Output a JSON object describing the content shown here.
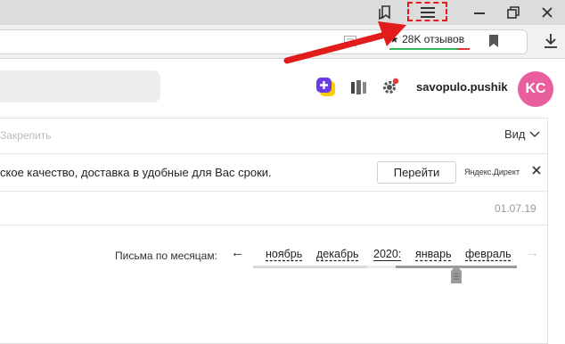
{
  "browser": {
    "reviews_text": "★ 28K отзывов"
  },
  "mail": {
    "username": "savopulo.pushik",
    "avatar_initials": "KC",
    "pin_label": "Закрепить",
    "view_label": "Вид",
    "ad": {
      "text": "ское качество, доставка в удобные для Вас сроки.",
      "button_label": "Перейти",
      "brand": "Яндекс.Директ"
    },
    "letter_date": "01.07.19",
    "months_nav": {
      "label": "Письма по месяцам:",
      "prev_arrow": "←",
      "next_arrow": "→",
      "items": [
        "ноябрь",
        "декабрь",
        "2020:",
        "январь",
        "февраль"
      ]
    }
  },
  "colors": {
    "highlight": "#e21b1b",
    "avatar": "#e95f9d",
    "reviews_good": "#33b75b",
    "reviews_bad": "#e03333"
  }
}
